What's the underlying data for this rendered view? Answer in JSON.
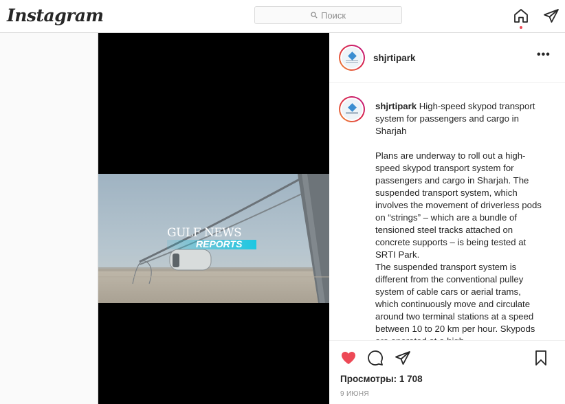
{
  "header": {
    "logo_text": "Instagram",
    "search_placeholder": "Поиск",
    "icons": [
      "search-icon",
      "home-icon",
      "direct-message-icon"
    ],
    "notification_dot_color": "#ed4956"
  },
  "video": {
    "watermark_line1": "GULF NEWS",
    "watermark_line2": "REPORTS"
  },
  "post": {
    "username": "shjrtipark",
    "caption_username": "shjrtipark",
    "caption_title": "High-speed skypod transport system for passengers and cargo in Sharjah",
    "caption_paragraph1": "Plans are underway to roll out a high-speed skypod transport system for passengers and cargo in Sharjah. The suspended transport system, which involves the movement of driverless pods on “strings” – which are a bundle of tensioned steel tracks attached on concrete supports – is being tested at SRTI Park.",
    "caption_paragraph2": "The suspended transport system is different from the conventional pulley system of cable cars or aerial trams, which continuously move and circulate around two terminal stations at a speed between 10 to 20 km per hour. Skypods are operated at a high",
    "views_label": "Просмотры: 1 708",
    "date": "9 ИЮНЯ",
    "liked": true,
    "like_color": "#ed4956",
    "action_icons": [
      "heart-icon",
      "comment-icon",
      "share-icon",
      "bookmark-icon",
      "more-options-icon"
    ]
  }
}
